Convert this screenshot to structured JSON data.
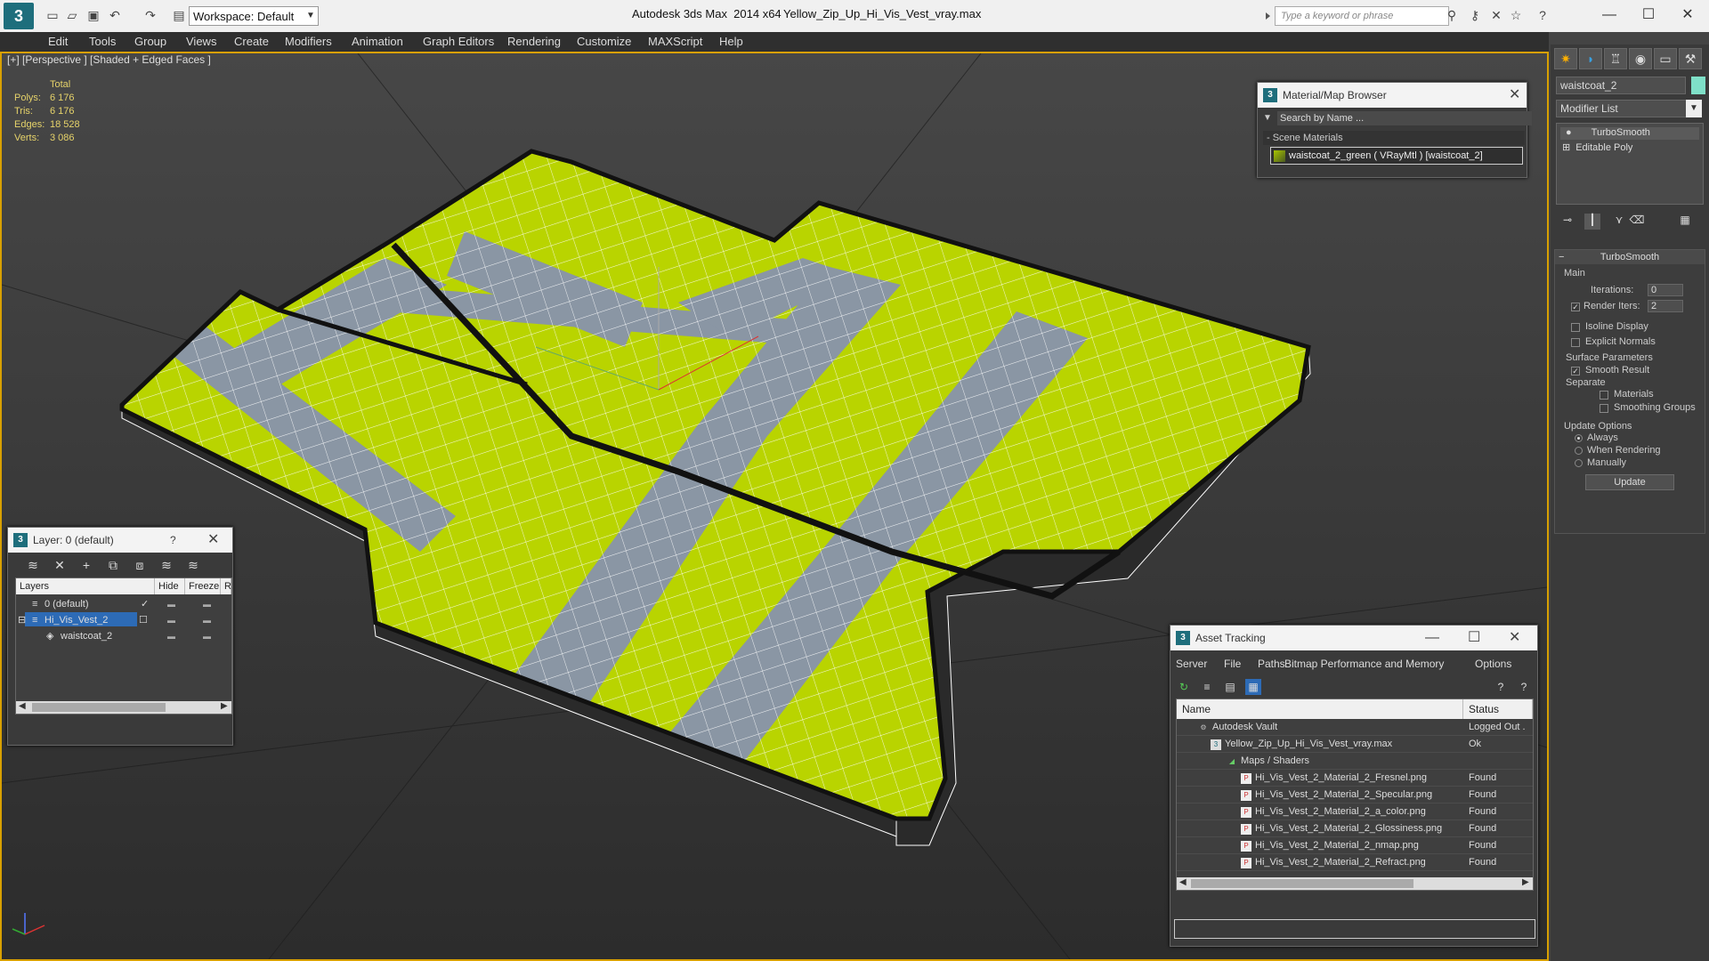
{
  "title_bar": {
    "app_title": "Autodesk 3ds Max  2014 x64",
    "file_name": "Yellow_Zip_Up_Hi_Vis_Vest_vray.max",
    "workspace_label": "Workspace: Default",
    "search_placeholder": "Type a keyword or phrase"
  },
  "menu": [
    "Edit",
    "Tools",
    "Group",
    "Views",
    "Create",
    "Modifiers",
    "Animation",
    "Graph Editors",
    "Rendering",
    "Customize",
    "MAXScript",
    "Help"
  ],
  "viewport": {
    "label": "[+] [Perspective ] [Shaded + Edged Faces ]",
    "stats": {
      "header": "Total",
      "rows": [
        {
          "k": "Polys:",
          "v": "6 176"
        },
        {
          "k": "Tris:",
          "v": "6 176"
        },
        {
          "k": "Edges:",
          "v": "18 528"
        },
        {
          "k": "Verts:",
          "v": "3 086"
        }
      ]
    },
    "colors": {
      "vest": "#b9d400",
      "strip": "#8a96a4",
      "wire": "#ffffff",
      "edge": "#111111"
    }
  },
  "command_panel": {
    "object_name": "waistcoat_2",
    "object_color": "#7fe0c8",
    "modifier_list": "Modifier List",
    "stack": [
      "TurboSmooth",
      "Editable Poly"
    ],
    "turbosmooth": {
      "title": "TurboSmooth",
      "main_label": "Main",
      "iterations_label": "Iterations:",
      "iterations": "0",
      "render_iters_label": "Render Iters:",
      "render_iters": "2",
      "render_iters_checked": true,
      "isoline_label": "Isoline Display",
      "explicit_label": "Explicit Normals",
      "surface_label": "Surface Parameters",
      "smooth_label": "Smooth Result",
      "separate_label": "Separate",
      "materials_label": "Materials",
      "smoothing_label": "Smoothing Groups",
      "update_options_label": "Update Options",
      "always_label": "Always",
      "when_rendering_label": "When Rendering",
      "manually_label": "Manually",
      "update_button": "Update"
    }
  },
  "material_browser": {
    "title": "Material/Map Browser",
    "search_placeholder": "Search by Name ...",
    "section": "- Scene Materials",
    "item": "waistcoat_2_green  ( VRayMtl )  [waistcoat_2]"
  },
  "layer_dialog": {
    "title": "Layer: 0 (default)",
    "help": "?",
    "headers": [
      "Layers",
      "Hide",
      "Freeze",
      "R"
    ],
    "rows": [
      {
        "name": "0 (default)"
      },
      {
        "name": "Hi_Vis_Vest_2"
      },
      {
        "name": "waistcoat_2"
      }
    ]
  },
  "asset_tracking": {
    "title": "Asset Tracking",
    "menu": [
      "Server",
      "File",
      "Paths",
      "Bitmap Performance and Memory",
      "Options"
    ],
    "headers": [
      "Name",
      "Status"
    ],
    "rows": [
      {
        "name": "Autodesk Vault",
        "status": "Logged Out ."
      },
      {
        "name": "Yellow_Zip_Up_Hi_Vis_Vest_vray.max",
        "status": "Ok"
      },
      {
        "name": "Maps / Shaders",
        "status": ""
      },
      {
        "name": "Hi_Vis_Vest_2_Material_2_Fresnel.png",
        "status": "Found"
      },
      {
        "name": "Hi_Vis_Vest_2_Material_2_Specular.png",
        "status": "Found"
      },
      {
        "name": "Hi_Vis_Vest_2_Material_2_a_color.png",
        "status": "Found"
      },
      {
        "name": "Hi_Vis_Vest_2_Material_2_Glossiness.png",
        "status": "Found"
      },
      {
        "name": "Hi_Vis_Vest_2_Material_2_nmap.png",
        "status": "Found"
      },
      {
        "name": "Hi_Vis_Vest_2_Material_2_Refract.png",
        "status": "Found"
      }
    ]
  }
}
